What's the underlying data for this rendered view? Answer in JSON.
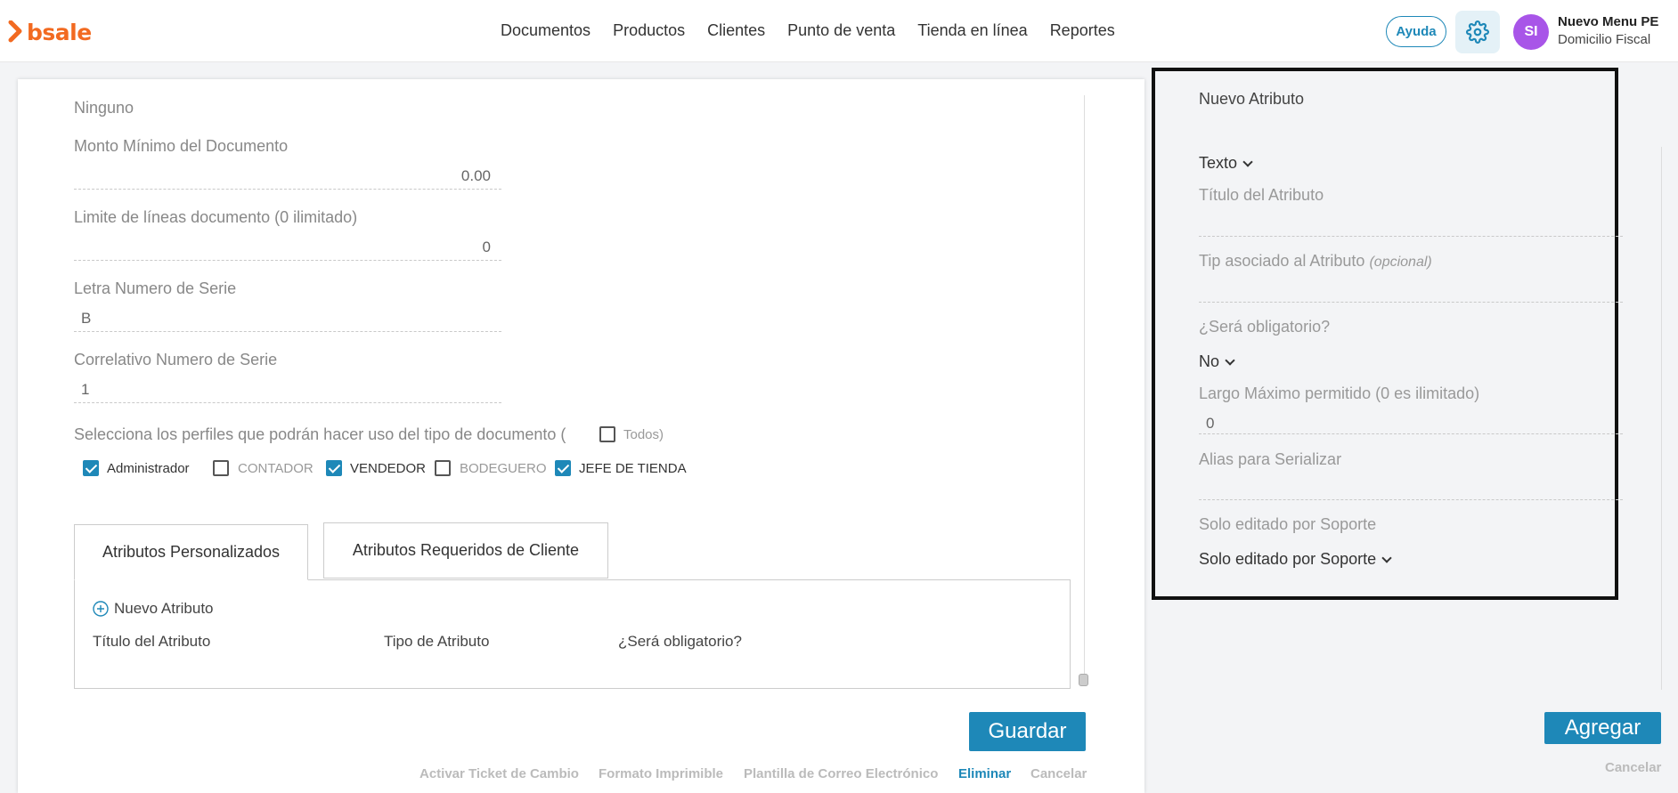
{
  "brand": {
    "name": "bsale",
    "accent": "#f26a21"
  },
  "nav": [
    "Documentos",
    "Productos",
    "Clientes",
    "Punto de venta",
    "Tienda en línea",
    "Reportes"
  ],
  "header": {
    "help": "Ayuda",
    "avatar_initials": "SI",
    "company_name": "Nuevo Menu PE",
    "company_sub": "Domicilio Fiscal"
  },
  "form": {
    "top_label": "Ninguno",
    "min_amount_label": "Monto Mínimo del Documento",
    "min_amount_value": "0.00",
    "line_limit_label": "Limite de líneas documento (0 ilimitado)",
    "line_limit_value": "0",
    "serie_letter_label": "Letra Numero de Serie",
    "serie_letter_value": "B",
    "serie_corr_label": "Correlativo Numero de Serie",
    "serie_corr_value": "1",
    "profiles_label": "Selecciona los perfiles que podrán hacer uso del tipo de documento (",
    "all_label": "Todos)",
    "profiles": [
      {
        "label": "Administrador",
        "checked": true
      },
      {
        "label": "CONTADOR",
        "checked": false
      },
      {
        "label": "VENDEDOR",
        "checked": true
      },
      {
        "label": "BODEGUERO",
        "checked": false
      },
      {
        "label": "JEFE DE TIENDA",
        "checked": true
      }
    ]
  },
  "tabs": [
    "Atributos Personalizados",
    "Atributos Requeridos de Cliente"
  ],
  "attributes_table": {
    "new_label": "Nuevo Atributo",
    "columns": [
      "Título del Atributo",
      "Tipo de Atributo",
      "¿Será obligatorio?"
    ]
  },
  "actions": {
    "save": "Guardar",
    "links": [
      "Activar Ticket de Cambio",
      "Formato Imprimible",
      "Plantilla de Correo Electrónico",
      "Eliminar",
      "Cancelar"
    ]
  },
  "side_panel": {
    "title": "Nuevo Atributo",
    "type_value": "Texto",
    "attr_title_label": "Título del Atributo",
    "tip_label": "Tip asociado al Atributo",
    "tip_optional": "(opcional)",
    "required_label": "¿Será obligatorio?",
    "required_value": "No",
    "max_len_label": "Largo Máximo permitido (0 es ilimitado)",
    "max_len_value": "0",
    "alias_label": "Alias para Serializar",
    "support_label": "Solo editado por Soporte",
    "support_value": "Solo editado por Soporte",
    "add": "Agregar",
    "cancel": "Cancelar"
  }
}
